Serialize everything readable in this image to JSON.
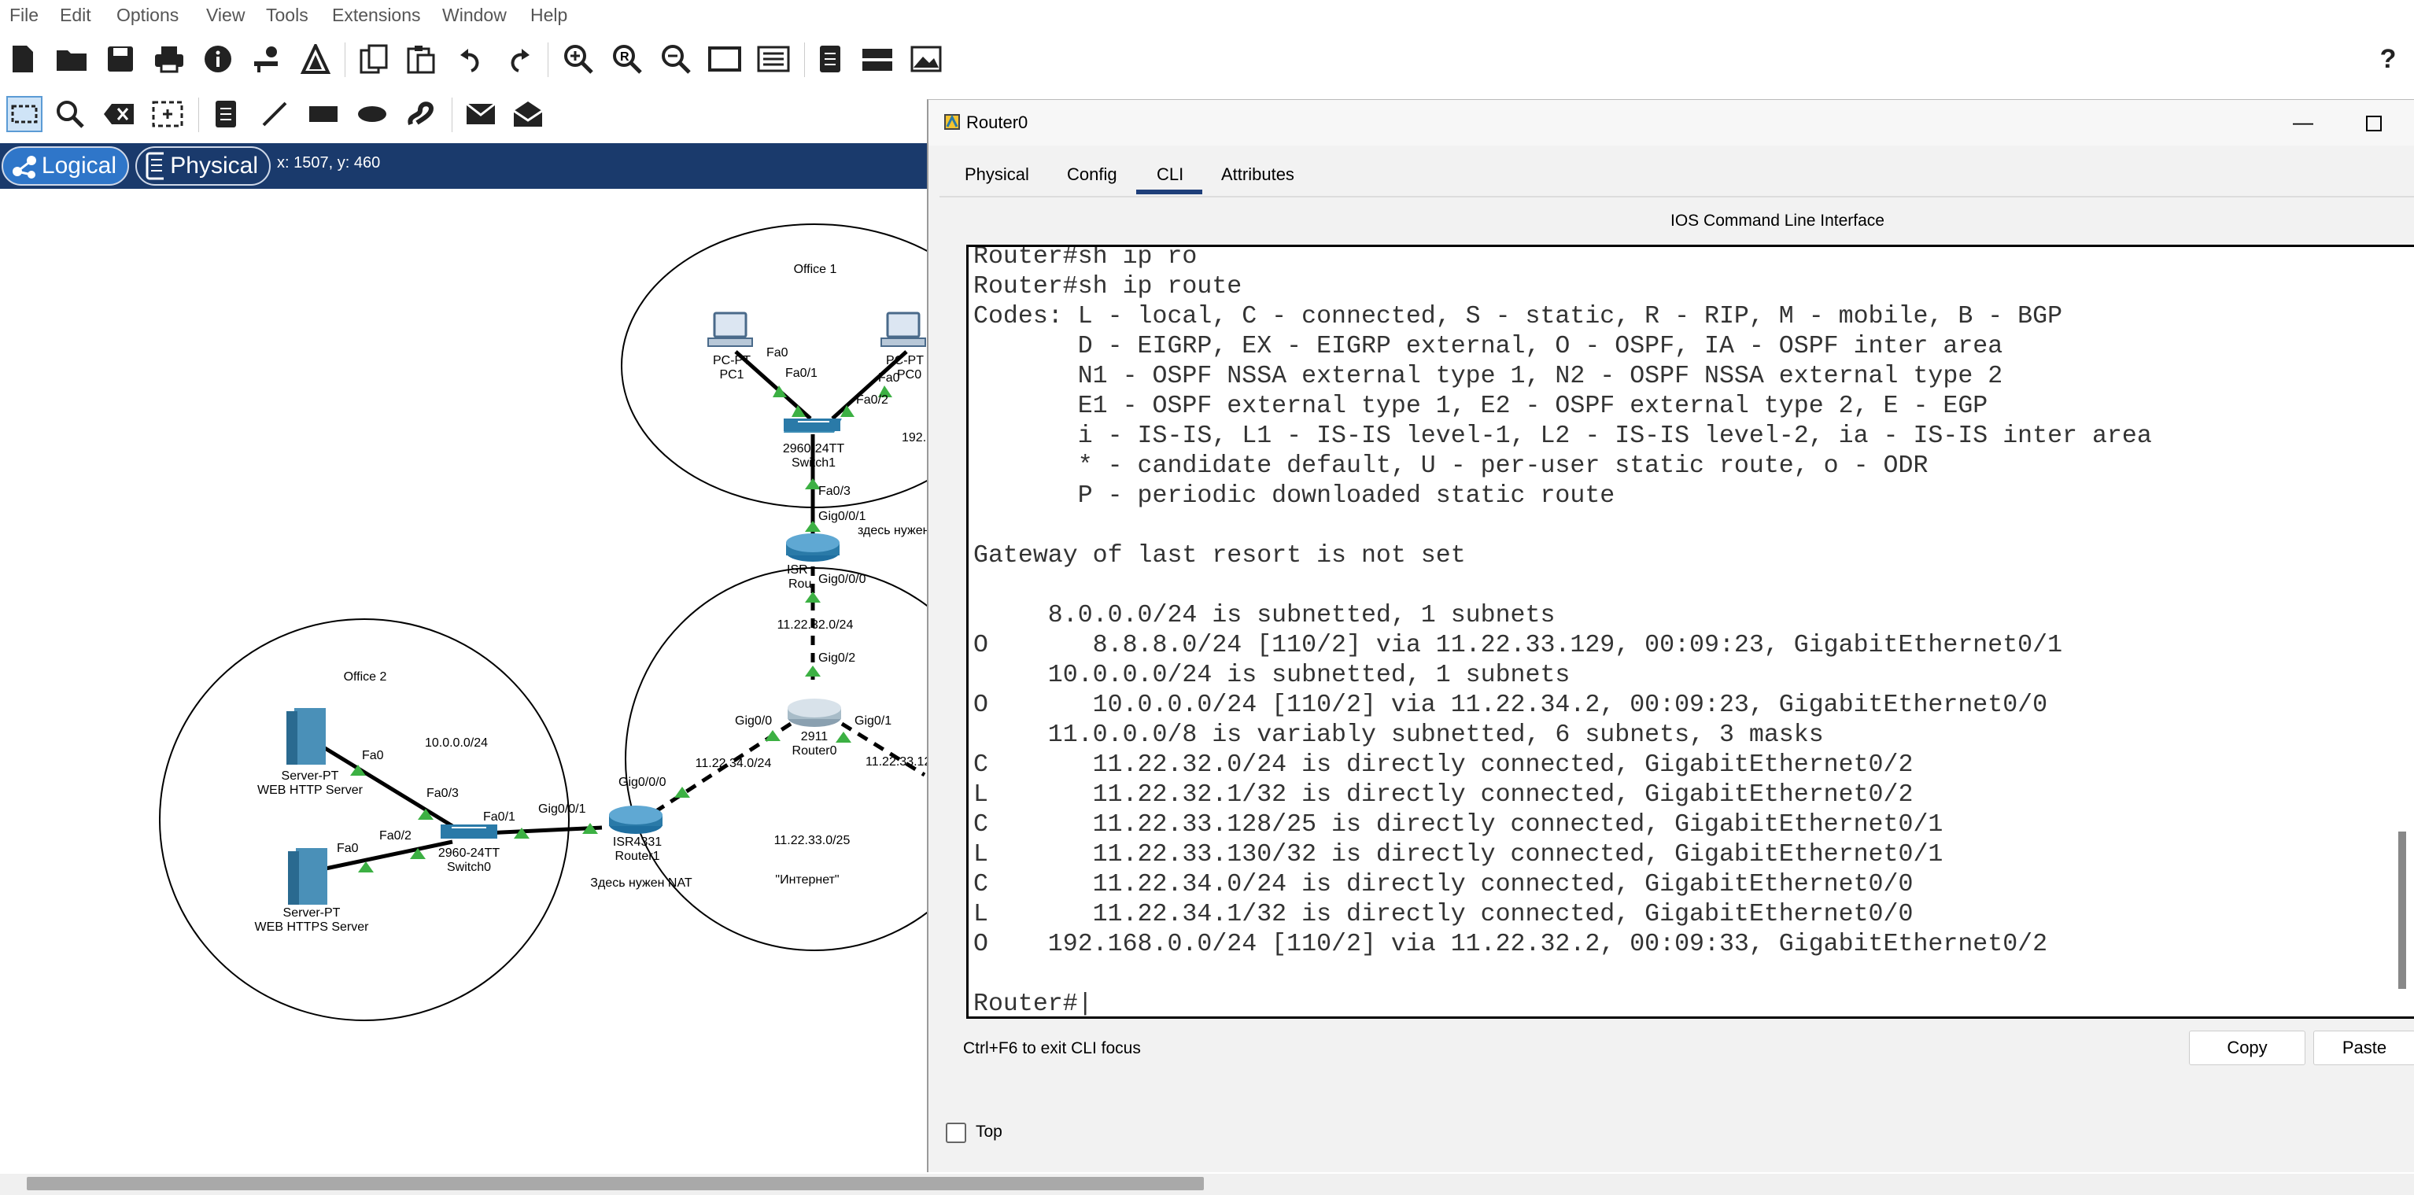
{
  "menu": [
    "File",
    "Edit",
    "Options",
    "View",
    "Tools",
    "Extensions",
    "Window",
    "Help"
  ],
  "toolbar": {
    "main_icons": [
      "new-file-icon",
      "open-folder-icon",
      "save-icon",
      "print-icon",
      "info-icon",
      "network-wizard-icon",
      "activity-wizard-icon",
      "copy-icon",
      "paste-icon",
      "undo-icon",
      "redo-icon",
      "zoom-in-icon",
      "zoom-reset-icon",
      "zoom-out-icon",
      "drawing-palette-icon",
      "custom-device-icon",
      "notes-icon",
      "device-template-icon",
      "screenshot-icon"
    ],
    "help_icon": "help-icon",
    "help_glyph": "?",
    "tools_icons": [
      "select-icon",
      "inspect-icon",
      "delete-icon",
      "resize-icon",
      "note-icon",
      "line-icon",
      "rectangle-icon",
      "ellipse-icon",
      "freeform-icon",
      "simple-pdu-icon",
      "complex-pdu-icon"
    ]
  },
  "modebar": {
    "logical": "Logical",
    "physical": "Physical",
    "coords": "x: 1507, y: 460"
  },
  "diagram": {
    "office1": "Office 1",
    "office2": "Office 2",
    "pc1_type": "PC-PT",
    "pc1_name": "PC1",
    "pc0_type": "PC-PT",
    "pc0_name": "PC0",
    "switch1_model": "2960-24TT",
    "switch1_name": "Switch1",
    "switch0_model": "2960-24TT",
    "switch0_name": "Switch0",
    "router0_model": "2911",
    "router0_name": "Router0",
    "router1_model": "ISR4331",
    "router1_name": "Router1",
    "router2_model": "ISR",
    "router2_name": "Rou",
    "srv1_type": "Server-PT",
    "srv1_name": "WEB HTTP Server",
    "srv2_type": "Server-PT",
    "srv2_name": "WEB HTTPS Server",
    "net_10": "10.0.0.0/24",
    "net_192": "192.",
    "net_32": "11.22.32.0/24",
    "net_34": "11.22.34.0/24",
    "net_33": "11.22.33.0/25",
    "net_33b": "11.22.33.12",
    "internet": "\"Интернет\"",
    "nat_note": "Здесь нужен NAT",
    "nat_note2": "здесь нужен",
    "ports": {
      "pc1_fa0": "Fa0",
      "sw1_fa01": "Fa0/1",
      "pc0_fa0": "Fa0",
      "sw1_fa02": "Fa0/2",
      "sw1_fa03": "Fa0/3",
      "r2_gig001": "Gig0/0/1",
      "r2_gig000": "Gig0/0/0",
      "r0_gig02": "Gig0/2",
      "r0_gig00": "Gig0/0",
      "r0_gig01": "Gig0/1",
      "r1_gig000": "Gig0/0/0",
      "r1_gig001": "Gig0/0/1",
      "sw0_fa01": "Fa0/1",
      "sw0_fa03": "Fa0/3",
      "sw0_fa02": "Fa0/2",
      "srv1_fa0": "Fa0",
      "srv2_fa0": "Fa0"
    }
  },
  "router_window": {
    "title": "Router0",
    "minimize_glyph": "—",
    "tabs": [
      "Physical",
      "Config",
      "CLI",
      "Attributes"
    ],
    "active_tab": "CLI",
    "heading": "IOS Command Line Interface",
    "cli_output": "Router#sh ip ro\nRouter#sh ip route\nCodes: L - local, C - connected, S - static, R - RIP, M - mobile, B - BGP\n       D - EIGRP, EX - EIGRP external, O - OSPF, IA - OSPF inter area\n       N1 - OSPF NSSA external type 1, N2 - OSPF NSSA external type 2\n       E1 - OSPF external type 1, E2 - OSPF external type 2, E - EGP\n       i - IS-IS, L1 - IS-IS level-1, L2 - IS-IS level-2, ia - IS-IS inter area\n       * - candidate default, U - per-user static route, o - ODR\n       P - periodic downloaded static route\n\nGateway of last resort is not set\n\n     8.0.0.0/24 is subnetted, 1 subnets\nO       8.8.8.0/24 [110/2] via 11.22.33.129, 00:09:23, GigabitEthernet0/1\n     10.0.0.0/24 is subnetted, 1 subnets\nO       10.0.0.0/24 [110/2] via 11.22.34.2, 00:09:23, GigabitEthernet0/0\n     11.0.0.0/8 is variably subnetted, 6 subnets, 3 masks\nC       11.22.32.0/24 is directly connected, GigabitEthernet0/2\nL       11.22.32.1/32 is directly connected, GigabitEthernet0/2\nC       11.22.33.128/25 is directly connected, GigabitEthernet0/1\nL       11.22.33.130/32 is directly connected, GigabitEthernet0/1\nC       11.22.34.0/24 is directly connected, GigabitEthernet0/0\nL       11.22.34.1/32 is directly connected, GigabitEthernet0/0\nO    192.168.0.0/24 [110/2] via 11.22.32.2, 00:09:33, GigabitEthernet0/2\n\nRouter#|",
    "hint": "Ctrl+F6 to exit CLI focus",
    "copy": "Copy",
    "paste": "Paste",
    "top_label": "Top",
    "top_checked": false
  }
}
